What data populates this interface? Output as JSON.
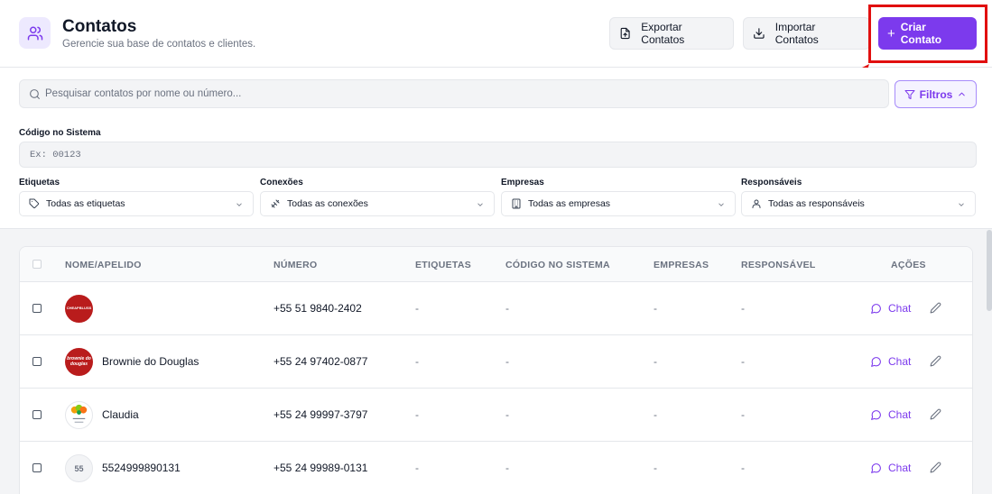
{
  "header": {
    "icon": "users-icon",
    "title": "Contatos",
    "subtitle": "Gerencie sua base de contatos e clientes.",
    "export_label": "Exportar Contatos",
    "import_label": "Importar Contatos",
    "create_label": "Criar Contato"
  },
  "search": {
    "placeholder": "Pesquisar contatos por nome ou número...",
    "filters_label": "Filtros"
  },
  "filters": {
    "code_label": "Código no Sistema",
    "code_placeholder": "Ex: 00123",
    "tags_label": "Etiquetas",
    "tags_value": "Todas as etiquetas",
    "connections_label": "Conexões",
    "connections_value": "Todas as conexões",
    "companies_label": "Empresas",
    "companies_value": "Todas as empresas",
    "owners_label": "Responsáveis",
    "owners_value": "Todas as responsáveis"
  },
  "table": {
    "columns": [
      "NOME/APELIDO",
      "NÚMERO",
      "ETIQUETAS",
      "CÓDIGO NO SISTEMA",
      "EMPRESAS",
      "RESPONSÁVEL",
      "AÇÕES"
    ],
    "chat_label": "Chat",
    "rows": [
      {
        "name": "",
        "avatar_text": "CHEAPBLUSS",
        "number": "+55 51 9840-2402",
        "tags": "-",
        "code": "-",
        "companies": "-",
        "owner": "-"
      },
      {
        "name": "Brownie do Douglas",
        "avatar_text": "brownie do douglas",
        "number": "+55 24 97402-0877",
        "tags": "-",
        "code": "-",
        "companies": "-",
        "owner": "-"
      },
      {
        "name": "Claudia",
        "avatar_text": "",
        "number": "+55 24 99997-3797",
        "tags": "-",
        "code": "-",
        "companies": "-",
        "owner": "-"
      },
      {
        "name": "5524999890131",
        "avatar_text": "55",
        "number": "+55 24 99989-0131",
        "tags": "-",
        "code": "-",
        "companies": "-",
        "owner": "-"
      }
    ]
  },
  "colors": {
    "accent": "#7c3aed",
    "highlight": "#e10f0f"
  }
}
